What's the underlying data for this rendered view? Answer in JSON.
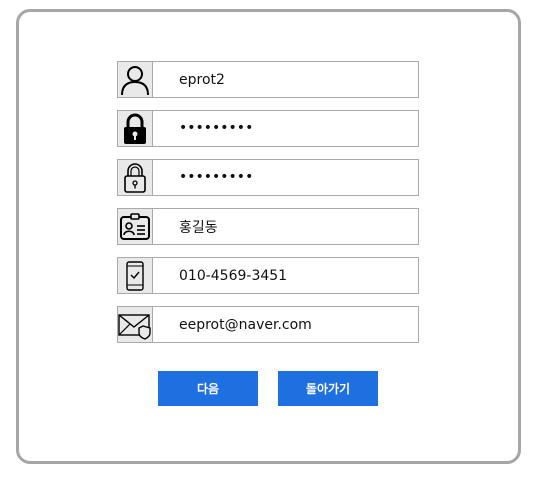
{
  "fields": {
    "username": {
      "value": "eprot2",
      "icon": "user-icon"
    },
    "password": {
      "value": "•••••••••",
      "icon": "lock-icon"
    },
    "password_confirm": {
      "value": "•••••••••",
      "icon": "lock-outline-icon"
    },
    "name": {
      "value": "홍길동",
      "icon": "id-card-icon"
    },
    "phone": {
      "value": "010-4569-3451",
      "icon": "phone-check-icon"
    },
    "email": {
      "value": "eeprot@naver.com",
      "icon": "mail-shield-icon"
    }
  },
  "buttons": {
    "next_label": "다음",
    "back_label": "돌아가기"
  },
  "colors": {
    "button_bg": "#1e6fe0",
    "card_border": "#a6a6a6",
    "icon_bg": "#e9e9e9"
  }
}
